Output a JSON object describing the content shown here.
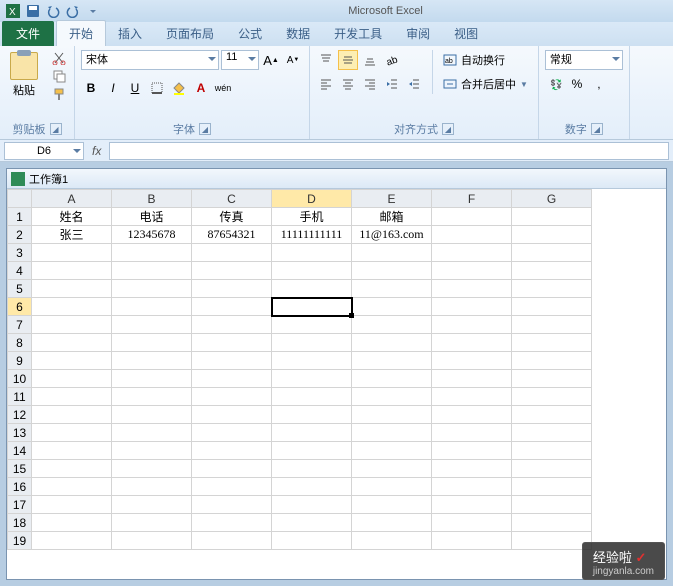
{
  "app": {
    "title": "Microsoft Excel"
  },
  "qat": {
    "save": "保存",
    "undo": "撤销",
    "redo": "重做"
  },
  "tabs": {
    "file": "文件",
    "items": [
      "开始",
      "插入",
      "页面布局",
      "公式",
      "数据",
      "开发工具",
      "审阅",
      "视图"
    ],
    "active_index": 0
  },
  "ribbon": {
    "clipboard": {
      "label": "剪贴板",
      "paste": "粘贴"
    },
    "font": {
      "label": "字体",
      "name": "宋体",
      "size": "11",
      "bold": "B",
      "italic": "I",
      "underline": "U"
    },
    "alignment": {
      "label": "对齐方式",
      "wrap": "自动换行",
      "merge": "合并后居中"
    },
    "number": {
      "label": "数字",
      "format": "常规"
    }
  },
  "namebox": "D6",
  "formula": "",
  "workbook": {
    "title": "工作簿1"
  },
  "grid": {
    "cols": [
      "A",
      "B",
      "C",
      "D",
      "E",
      "F",
      "G"
    ],
    "rows": [
      "1",
      "2",
      "3",
      "4",
      "5",
      "6",
      "7",
      "8",
      "9",
      "10",
      "11",
      "12",
      "13",
      "14",
      "15",
      "16",
      "17",
      "18",
      "19"
    ],
    "selected_col": "D",
    "selected_row": "6",
    "data": {
      "A1": "姓名",
      "B1": "电话",
      "C1": "传真",
      "D1": "手机",
      "E1": "邮箱",
      "A2": "张三",
      "B2": "12345678",
      "C2": "87654321",
      "D2": "11111111111",
      "E2": "11@163.com"
    }
  },
  "watermark": {
    "brand": "经验啦",
    "url": "jingyanla.com"
  }
}
